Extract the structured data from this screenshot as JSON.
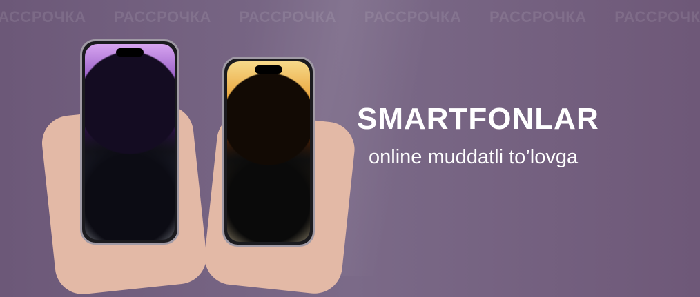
{
  "watermark": {
    "text": "РАССРОЧКА",
    "repeat": 6
  },
  "banner": {
    "title": "SMARTFONLAR",
    "subtitle": "online muddatli to’lovga"
  },
  "colors": {
    "background": "#735f80",
    "text": "#ffffff"
  }
}
